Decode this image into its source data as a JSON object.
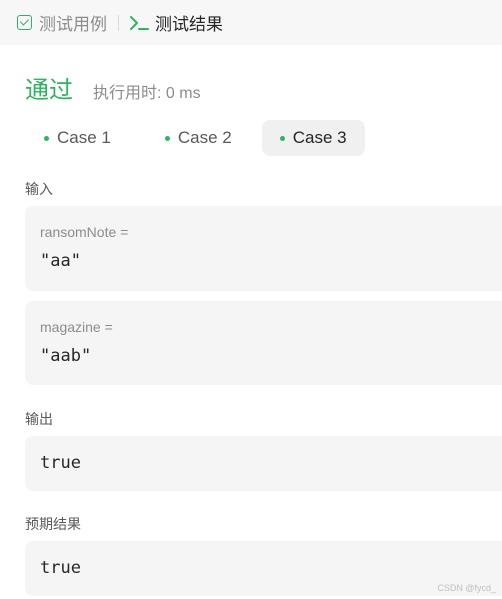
{
  "tabs": {
    "testcase_label": "测试用例",
    "result_label": "测试结果"
  },
  "status": {
    "text": "通过",
    "runtime": "执行用时: 0 ms"
  },
  "cases": [
    "Case 1",
    "Case 2",
    "Case 3"
  ],
  "active_case": "Case 3",
  "input": {
    "label": "输入",
    "params": [
      {
        "name": "ransomNote =",
        "value": "\"aa\""
      },
      {
        "name": "magazine =",
        "value": "\"aab\""
      }
    ]
  },
  "output": {
    "label": "输出",
    "value": "true"
  },
  "expected": {
    "label": "预期结果",
    "value": "true"
  },
  "watermark": "CSDN @fycd_",
  "colors": {
    "accent": "#2db55d",
    "box_bg": "#f5f5f5",
    "tabbar_bg": "#f7f7f7"
  }
}
